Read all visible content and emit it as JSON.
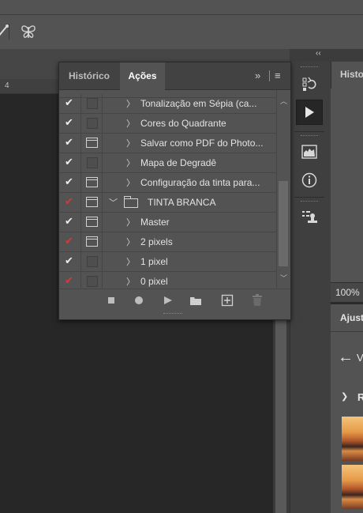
{
  "colors": {
    "accent_check_red": "#d23b3b",
    "panel_bg": "#535353",
    "canvas_bg": "#272727"
  },
  "ruler": {
    "tick_label": "4"
  },
  "actions_panel": {
    "tabs": [
      {
        "label": "Histórico",
        "active": false
      },
      {
        "label": "Ações",
        "active": true
      }
    ],
    "menu_icons": [
      "expand-chevrons-icon",
      "panel-menu-icon"
    ],
    "rows": [
      {
        "label": "Tonalização em Sépia (ca...",
        "checked": true,
        "check_color": "white",
        "dialog": false,
        "expanded": false,
        "type": "action"
      },
      {
        "label": "Cores do Quadrante",
        "checked": true,
        "check_color": "white",
        "dialog": false,
        "expanded": false,
        "type": "action"
      },
      {
        "label": "Salvar como PDF do Photo...",
        "checked": true,
        "check_color": "white",
        "dialog": true,
        "expanded": false,
        "type": "action"
      },
      {
        "label": "Mapa de Degradê",
        "checked": true,
        "check_color": "white",
        "dialog": false,
        "expanded": false,
        "type": "action"
      },
      {
        "label": "Configuração da tinta para...",
        "checked": true,
        "check_color": "white",
        "dialog": true,
        "expanded": false,
        "type": "action"
      },
      {
        "label": "TINTA BRANCA",
        "checked": true,
        "check_color": "red",
        "dialog": true,
        "expanded": true,
        "type": "set"
      },
      {
        "label": "Master",
        "checked": true,
        "check_color": "white",
        "dialog": true,
        "expanded": false,
        "type": "action"
      },
      {
        "label": "2 pixels",
        "checked": true,
        "check_color": "red",
        "dialog": true,
        "expanded": false,
        "type": "action"
      },
      {
        "label": "1 pixel",
        "checked": true,
        "check_color": "white",
        "dialog": false,
        "expanded": false,
        "type": "action"
      },
      {
        "label": "0 pixel",
        "checked": true,
        "check_color": "red",
        "dialog": false,
        "expanded": false,
        "type": "action"
      }
    ],
    "footer_buttons": [
      "stop-icon",
      "record-icon",
      "play-icon",
      "new-set-folder-icon",
      "new-action-icon",
      "delete-icon"
    ]
  },
  "dock": {
    "collapse_glyph": "‹‹",
    "buttons": [
      "history-icon",
      "actions-play-icon",
      "histogram-icon",
      "info-icon",
      "clone-source-icon"
    ]
  },
  "right_panel_top": {
    "tab_label": "Histo"
  },
  "zoom": {
    "value": "100%"
  },
  "right_panel_bottom": {
    "tab_label": "Ajust",
    "back_label": "V",
    "section_label": "R"
  }
}
